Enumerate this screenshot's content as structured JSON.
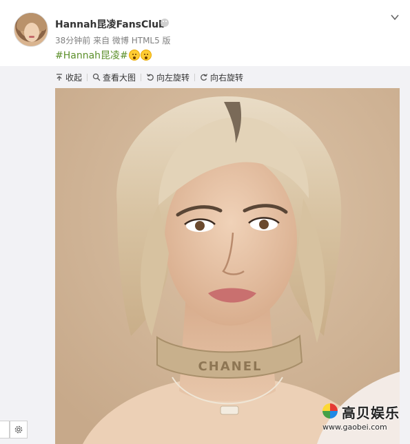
{
  "post": {
    "username": "Hannah昆凌FansClub",
    "time_source": "38分钟前 来自 微博 HTML5 版",
    "hashtag": "#Hannah昆凌#",
    "emojis": [
      "astonished-face-emoji",
      "astonished-face-emoji"
    ]
  },
  "toolbar": {
    "collapse_label": "收起",
    "view_large_label": "查看大图",
    "rotate_left_label": "向左旋转",
    "rotate_right_label": "向右旋转"
  },
  "photo": {
    "chain_text": "CHANEL"
  },
  "watermark": {
    "title": "高贝娱乐",
    "url": "www.gaobei.com"
  },
  "colors": {
    "hashtag": "#5b8f2a",
    "toolbar_bg": "#f2f2f5",
    "photo_bg": "#d2b79c"
  }
}
